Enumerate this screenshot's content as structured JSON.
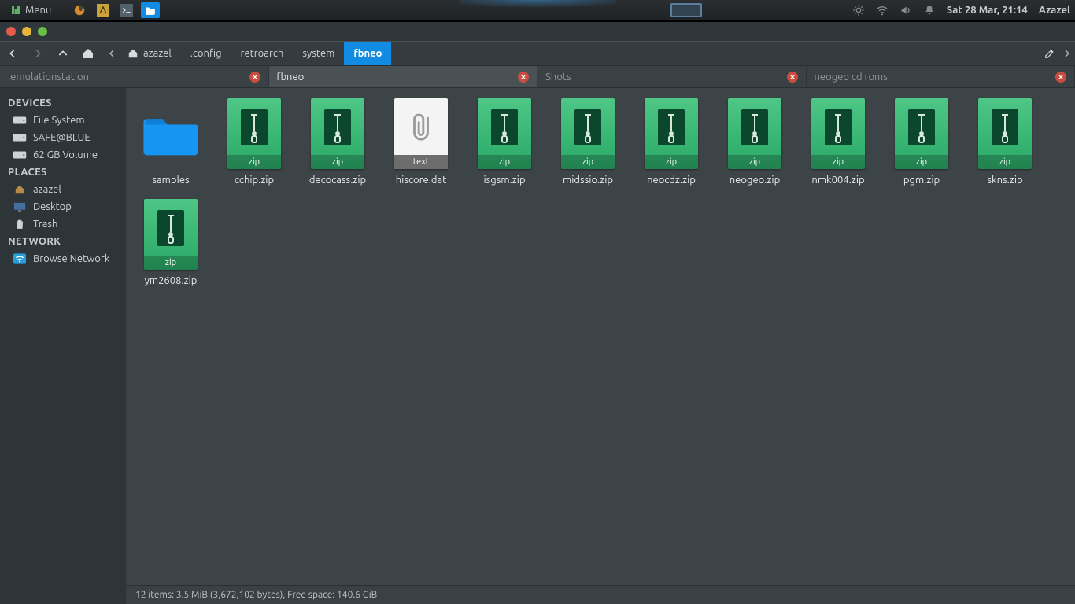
{
  "menubar": {
    "menu_label": "Menu",
    "datetime": "Sat 28 Mar, 21:14",
    "user": "Azazel"
  },
  "toolbar": {
    "breadcrumb": [
      "azazel",
      ".config",
      "retroarch",
      "system",
      "fbneo"
    ]
  },
  "tabs": [
    {
      "label": ".emulationstation",
      "active": false
    },
    {
      "label": "fbneo",
      "active": true
    },
    {
      "label": "Shots",
      "active": false
    },
    {
      "label": "neogeo cd roms",
      "active": false
    }
  ],
  "sidebar": {
    "sections": [
      {
        "header": "DEVICES",
        "items": [
          {
            "label": "File System",
            "icon": "drive"
          },
          {
            "label": "SAFE@BLUE",
            "icon": "drive"
          },
          {
            "label": "62 GB Volume",
            "icon": "drive"
          }
        ]
      },
      {
        "header": "PLACES",
        "items": [
          {
            "label": "azazel",
            "icon": "home"
          },
          {
            "label": "Desktop",
            "icon": "desktop"
          },
          {
            "label": "Trash",
            "icon": "trash"
          }
        ]
      },
      {
        "header": "NETWORK",
        "items": [
          {
            "label": "Browse Network",
            "icon": "network"
          }
        ]
      }
    ]
  },
  "files": [
    {
      "name": "samples",
      "type": "folder"
    },
    {
      "name": "cchip.zip",
      "type": "zip"
    },
    {
      "name": "decocass.zip",
      "type": "zip"
    },
    {
      "name": "hiscore.dat",
      "type": "text"
    },
    {
      "name": "isgsm.zip",
      "type": "zip"
    },
    {
      "name": "midssio.zip",
      "type": "zip"
    },
    {
      "name": "neocdz.zip",
      "type": "zip"
    },
    {
      "name": "neogeo.zip",
      "type": "zip"
    },
    {
      "name": "nmk004.zip",
      "type": "zip"
    },
    {
      "name": "pgm.zip",
      "type": "zip"
    },
    {
      "name": "skns.zip",
      "type": "zip"
    },
    {
      "name": "ym2608.zip",
      "type": "zip"
    }
  ],
  "icon_badges": {
    "zip": "zip",
    "text": "text"
  },
  "status": "12 items: 3.5  MiB (3,672,102 bytes), Free space: 140.6  GiB"
}
